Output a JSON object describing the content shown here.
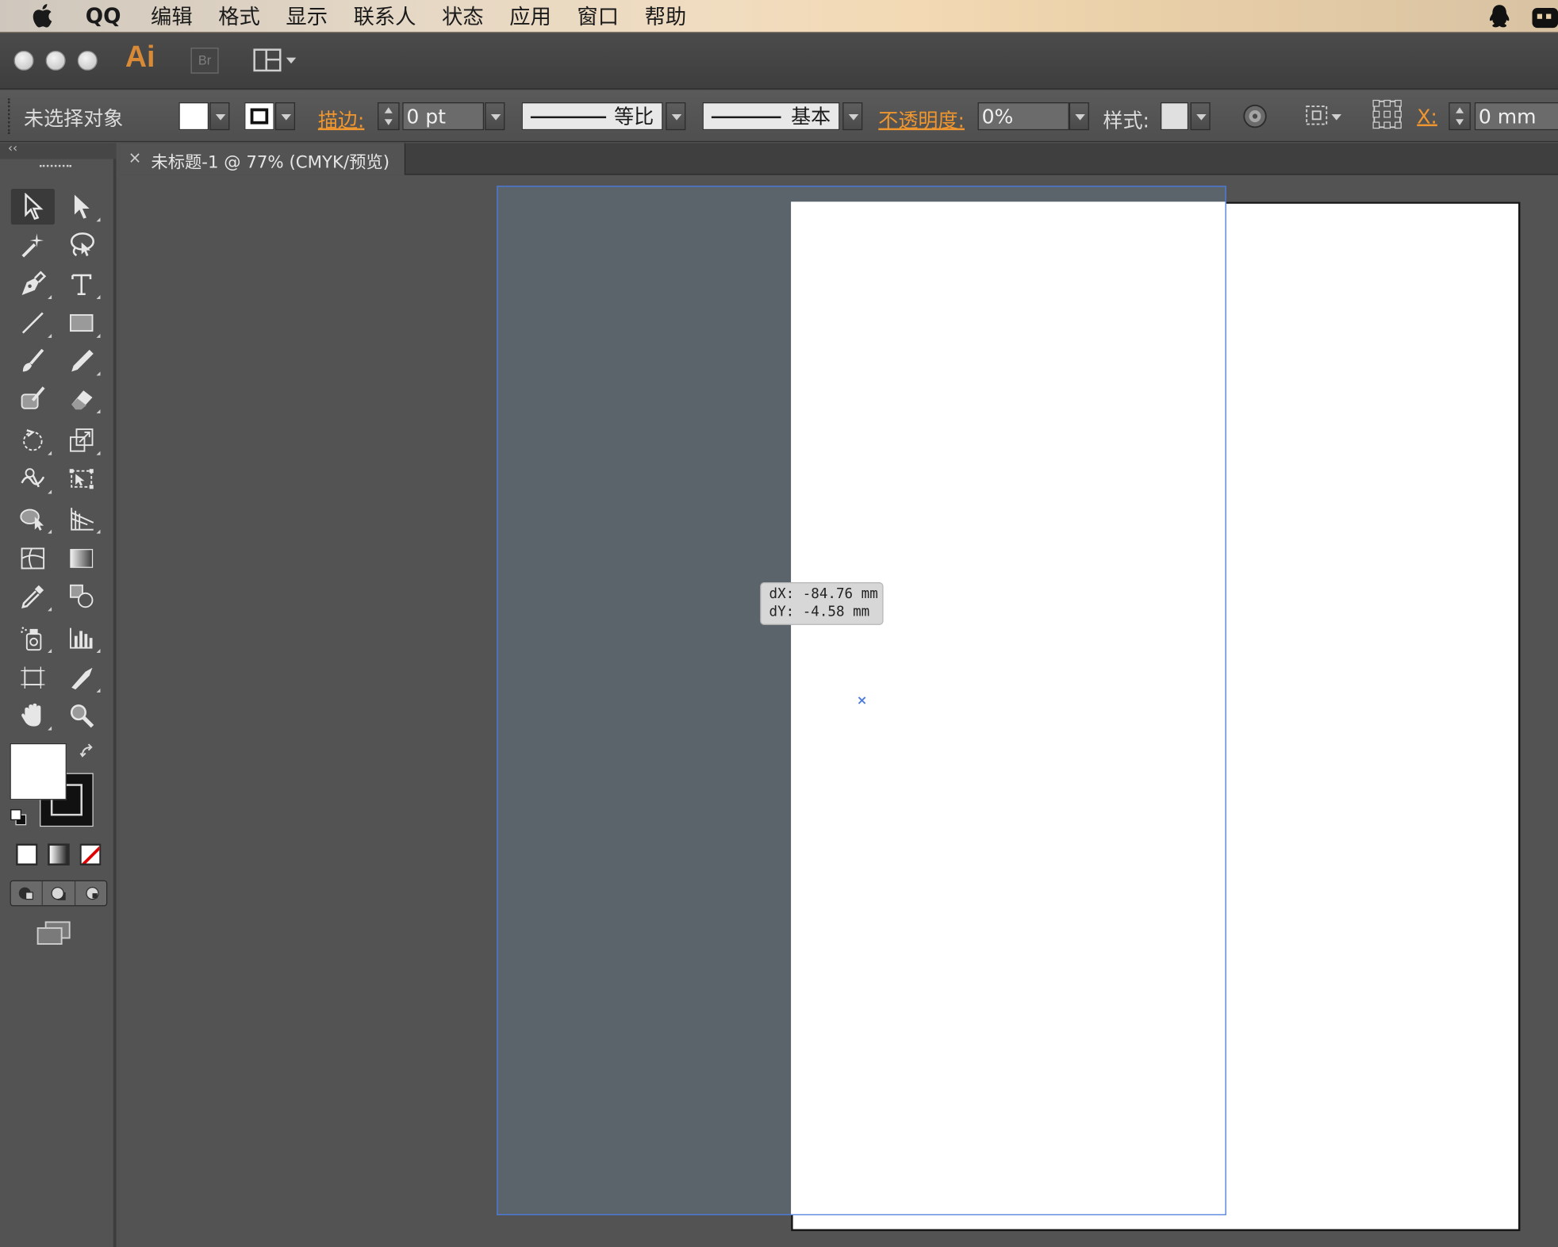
{
  "menubar": {
    "app_name": "QQ",
    "items": [
      "编辑",
      "格式",
      "显示",
      "联系人",
      "状态",
      "应用",
      "窗口",
      "帮助"
    ]
  },
  "titlebar": {
    "app_logo": "Ai",
    "bridge_label": "Br"
  },
  "control_bar": {
    "selection_status": "未选择对象",
    "stroke_label": "描边:",
    "stroke_weight": "0 pt",
    "stroke_profile": "等比",
    "brush_label": "基本",
    "opacity_label": "不透明度:",
    "opacity_value": "0%",
    "style_label": "样式:",
    "x_label": "X:",
    "x_value": "0 mm"
  },
  "document_tab": {
    "close": "×",
    "title": "未标题-1 @ 77% (CMYK/预览)"
  },
  "tooltip": {
    "dx": "dX: -84.76 mm",
    "dy": "dY: -4.58 mm"
  },
  "cursor_mark": "×",
  "colors": {
    "accent_orange": "#f0962e",
    "selection_blue": "#4b7bdc",
    "panel_bg": "#535353"
  },
  "tools": [
    "selection-tool",
    "direct-selection-tool",
    "magic-wand-tool",
    "lasso-tool",
    "pen-tool",
    "type-tool",
    "line-segment-tool",
    "rectangle-tool",
    "paintbrush-tool",
    "pencil-tool",
    "blob-brush-tool",
    "eraser-tool",
    "rotate-tool",
    "scale-tool",
    "warp-tool",
    "free-transform-tool",
    "shape-builder-tool",
    "perspective-grid-tool",
    "mesh-tool",
    "gradient-tool",
    "eyedropper-tool",
    "blend-tool",
    "symbol-sprayer-tool",
    "column-graph-tool",
    "artboard-tool",
    "slice-tool",
    "hand-tool",
    "zoom-tool"
  ]
}
